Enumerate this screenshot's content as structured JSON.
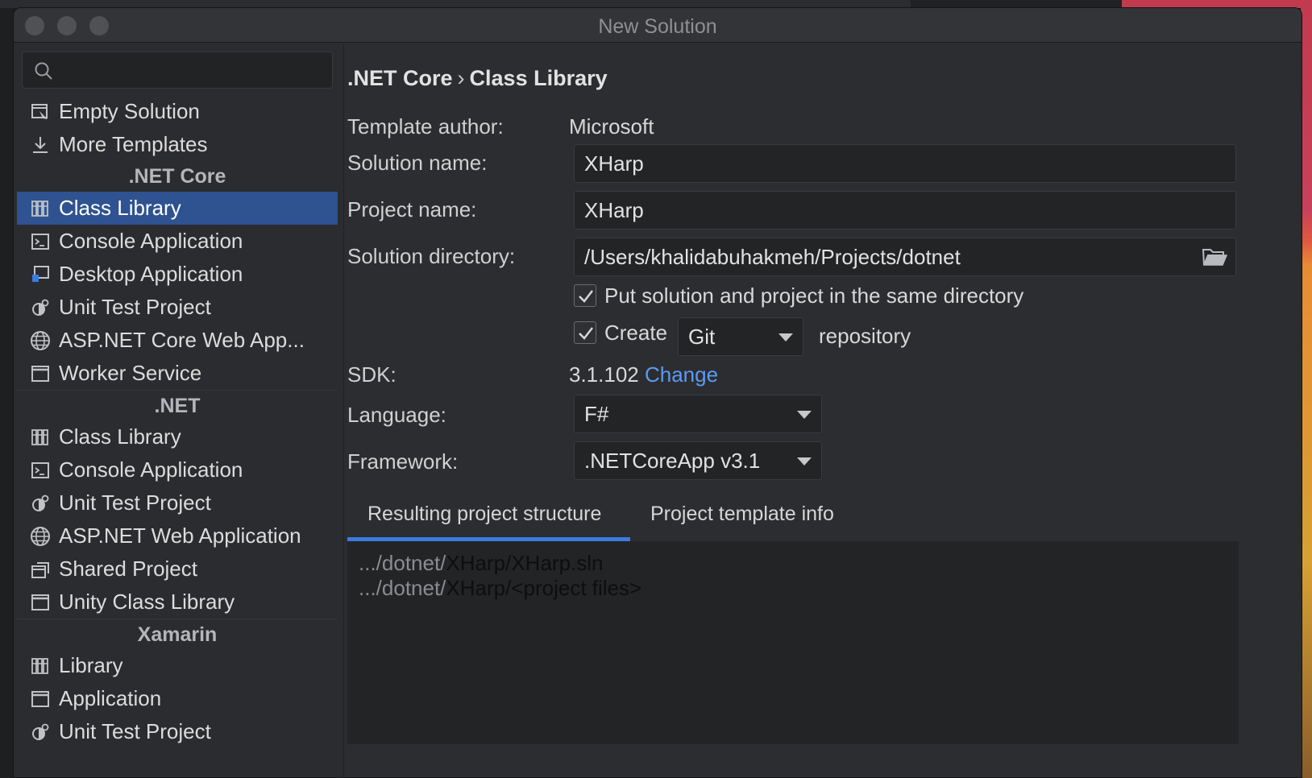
{
  "window": {
    "title": "New Solution"
  },
  "search": {
    "placeholder": ""
  },
  "sidebar": {
    "top_items": [
      {
        "label": "Empty Solution",
        "icon": "empty-solution-icon"
      },
      {
        "label": "More Templates",
        "icon": "download-icon"
      }
    ],
    "groups": [
      {
        "title": ".NET Core",
        "items": [
          {
            "label": "Class Library",
            "icon": "library-icon",
            "selected": true
          },
          {
            "label": "Console Application",
            "icon": "console-icon"
          },
          {
            "label": "Desktop Application",
            "icon": "desktop-app-icon"
          },
          {
            "label": "Unit Test Project",
            "icon": "test-icon"
          },
          {
            "label": "ASP.NET Core Web App...",
            "icon": "globe-icon"
          },
          {
            "label": "Worker Service",
            "icon": "window-icon"
          }
        ]
      },
      {
        "title": ".NET",
        "items": [
          {
            "label": "Class Library",
            "icon": "library-icon"
          },
          {
            "label": "Console Application",
            "icon": "console-icon"
          },
          {
            "label": "Unit Test Project",
            "icon": "test-icon"
          },
          {
            "label": "ASP.NET Web Application",
            "icon": "globe-icon"
          },
          {
            "label": "Shared Project",
            "icon": "shared-project-icon"
          },
          {
            "label": "Unity Class Library",
            "icon": "window-icon"
          }
        ]
      },
      {
        "title": "Xamarin",
        "items": [
          {
            "label": "Library",
            "icon": "library-icon"
          },
          {
            "label": "Application",
            "icon": "window-icon"
          },
          {
            "label": "Unit Test Project",
            "icon": "test-icon"
          }
        ]
      }
    ]
  },
  "main": {
    "breadcrumb": {
      "parent": ".NET Core",
      "separator": "›",
      "current": "Class Library"
    },
    "template_author": {
      "label": "Template author:",
      "value": "Microsoft"
    },
    "solution_name": {
      "label": "Solution name:",
      "value": "XHarp"
    },
    "project_name": {
      "label": "Project name:",
      "value": "XHarp"
    },
    "solution_directory": {
      "label": "Solution directory:",
      "value": "/Users/khalidabuhakmeh/Projects/dotnet"
    },
    "same_directory": {
      "label": "Put solution and project in the same directory",
      "checked": true
    },
    "create_repo": {
      "label": "Create",
      "vcs": "Git",
      "suffix": "repository",
      "checked": true
    },
    "sdk": {
      "label": "SDK:",
      "value": "3.1.102",
      "change": "Change"
    },
    "language": {
      "label": "Language:",
      "value": "F#"
    },
    "framework": {
      "label": "Framework:",
      "value": ".NETCoreApp v3.1"
    },
    "tabs": [
      {
        "label": "Resulting project structure",
        "active": true
      },
      {
        "label": "Project template info",
        "active": false
      }
    ],
    "structure": [
      {
        "prefix": ".../dotnet/",
        "path": "XHarp/XHarp.sln"
      },
      {
        "prefix": ".../dotnet/",
        "path": "XHarp/<project files>"
      }
    ]
  },
  "colors": {
    "accent": "#2f5290",
    "link": "#5b9bf3",
    "tab_underline": "#3b7be0",
    "background": "#2c2d30"
  }
}
